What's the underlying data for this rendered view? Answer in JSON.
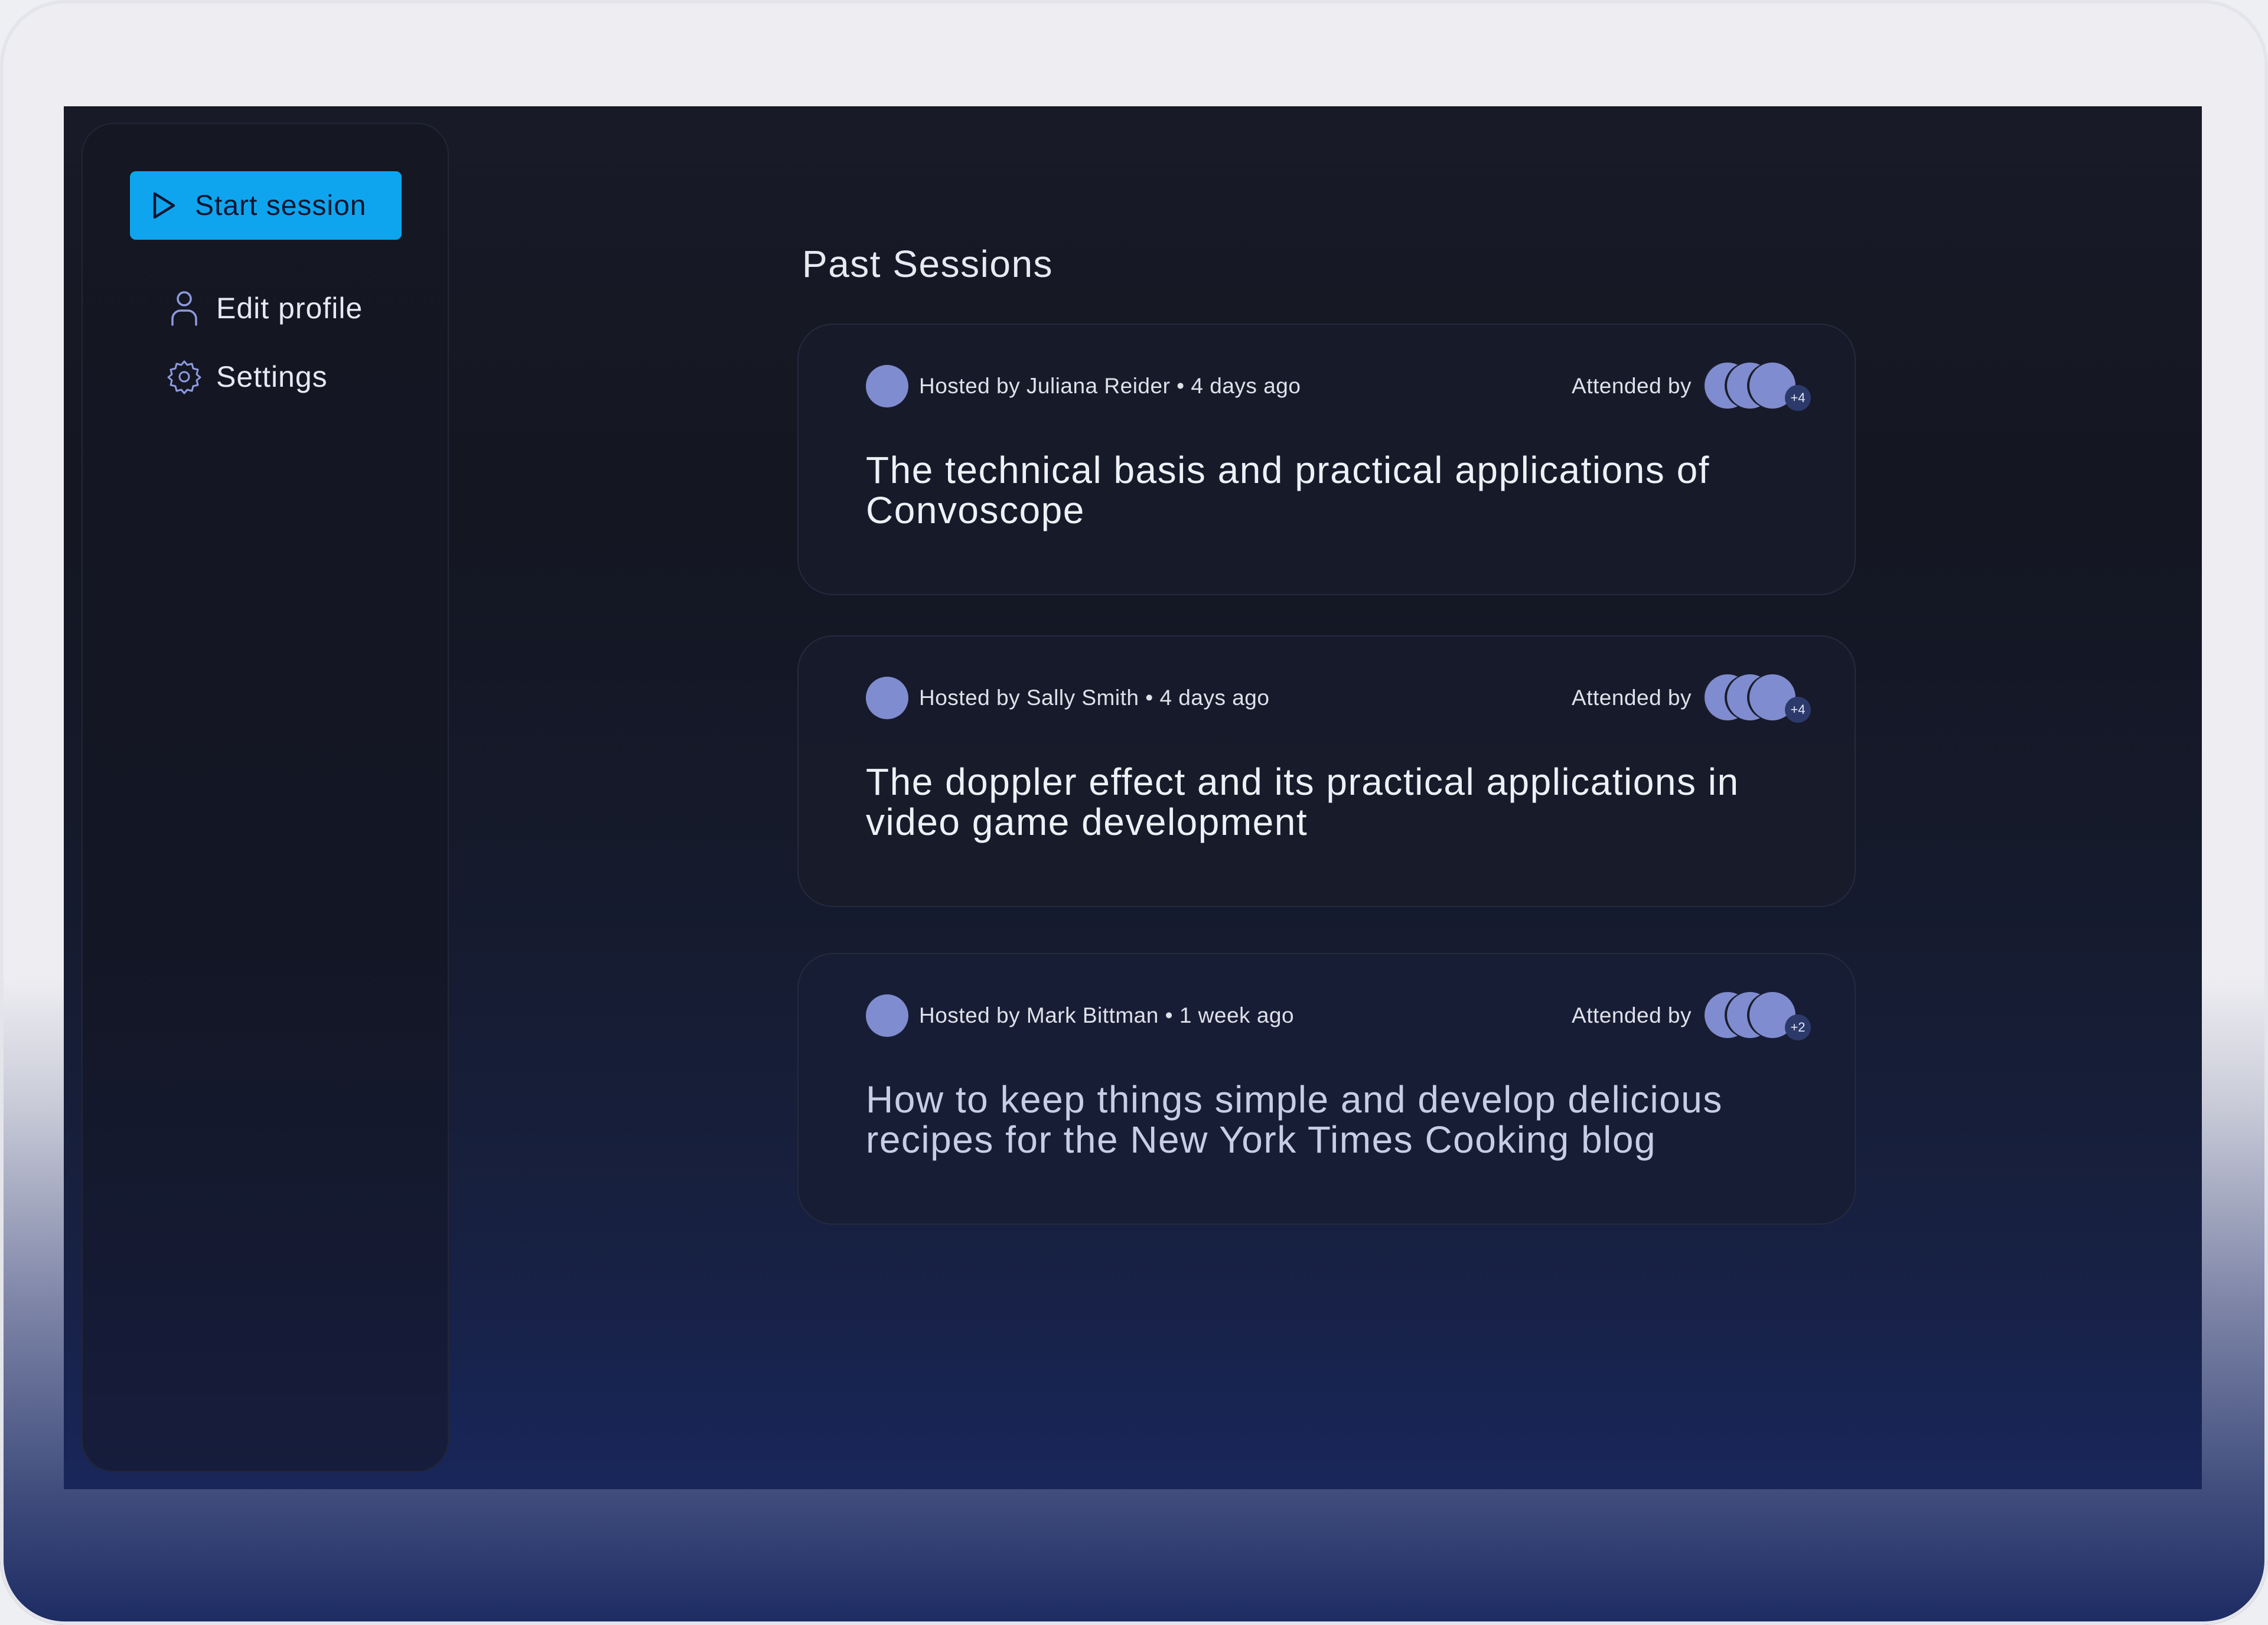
{
  "sidebar": {
    "start_session": {
      "label": "Start session",
      "icon": "play-icon"
    },
    "edit_profile": {
      "label": "Edit profile",
      "icon": "user-icon"
    },
    "settings": {
      "label": "Settings",
      "icon": "gear-icon"
    }
  },
  "main": {
    "title": "Past Sessions",
    "sessions": [
      {
        "host": "Hosted by Juliana Reider • 4 days ago",
        "attended_label": "Attended by",
        "extra_attendees": "+4",
        "title": "The technical basis and practical applications of Convoscope"
      },
      {
        "host": "Hosted by Sally Smith • 4 days ago",
        "attended_label": "Attended by",
        "extra_attendees": "+4",
        "title": "The doppler effect and its practical applications in video game development"
      },
      {
        "host": "Hosted by Mark Bittman • 1 week ago",
        "attended_label": "Attended by",
        "extra_attendees": "+2",
        "title": "How to keep things simple and develop delicious recipes for the New York Times Cooking blog"
      }
    ]
  },
  "colors": {
    "accent": "#0ea5ee",
    "avatar": "#7f8ccf",
    "background": "#141621",
    "card_border": "#262a3e",
    "text": "#e8e9f1"
  }
}
